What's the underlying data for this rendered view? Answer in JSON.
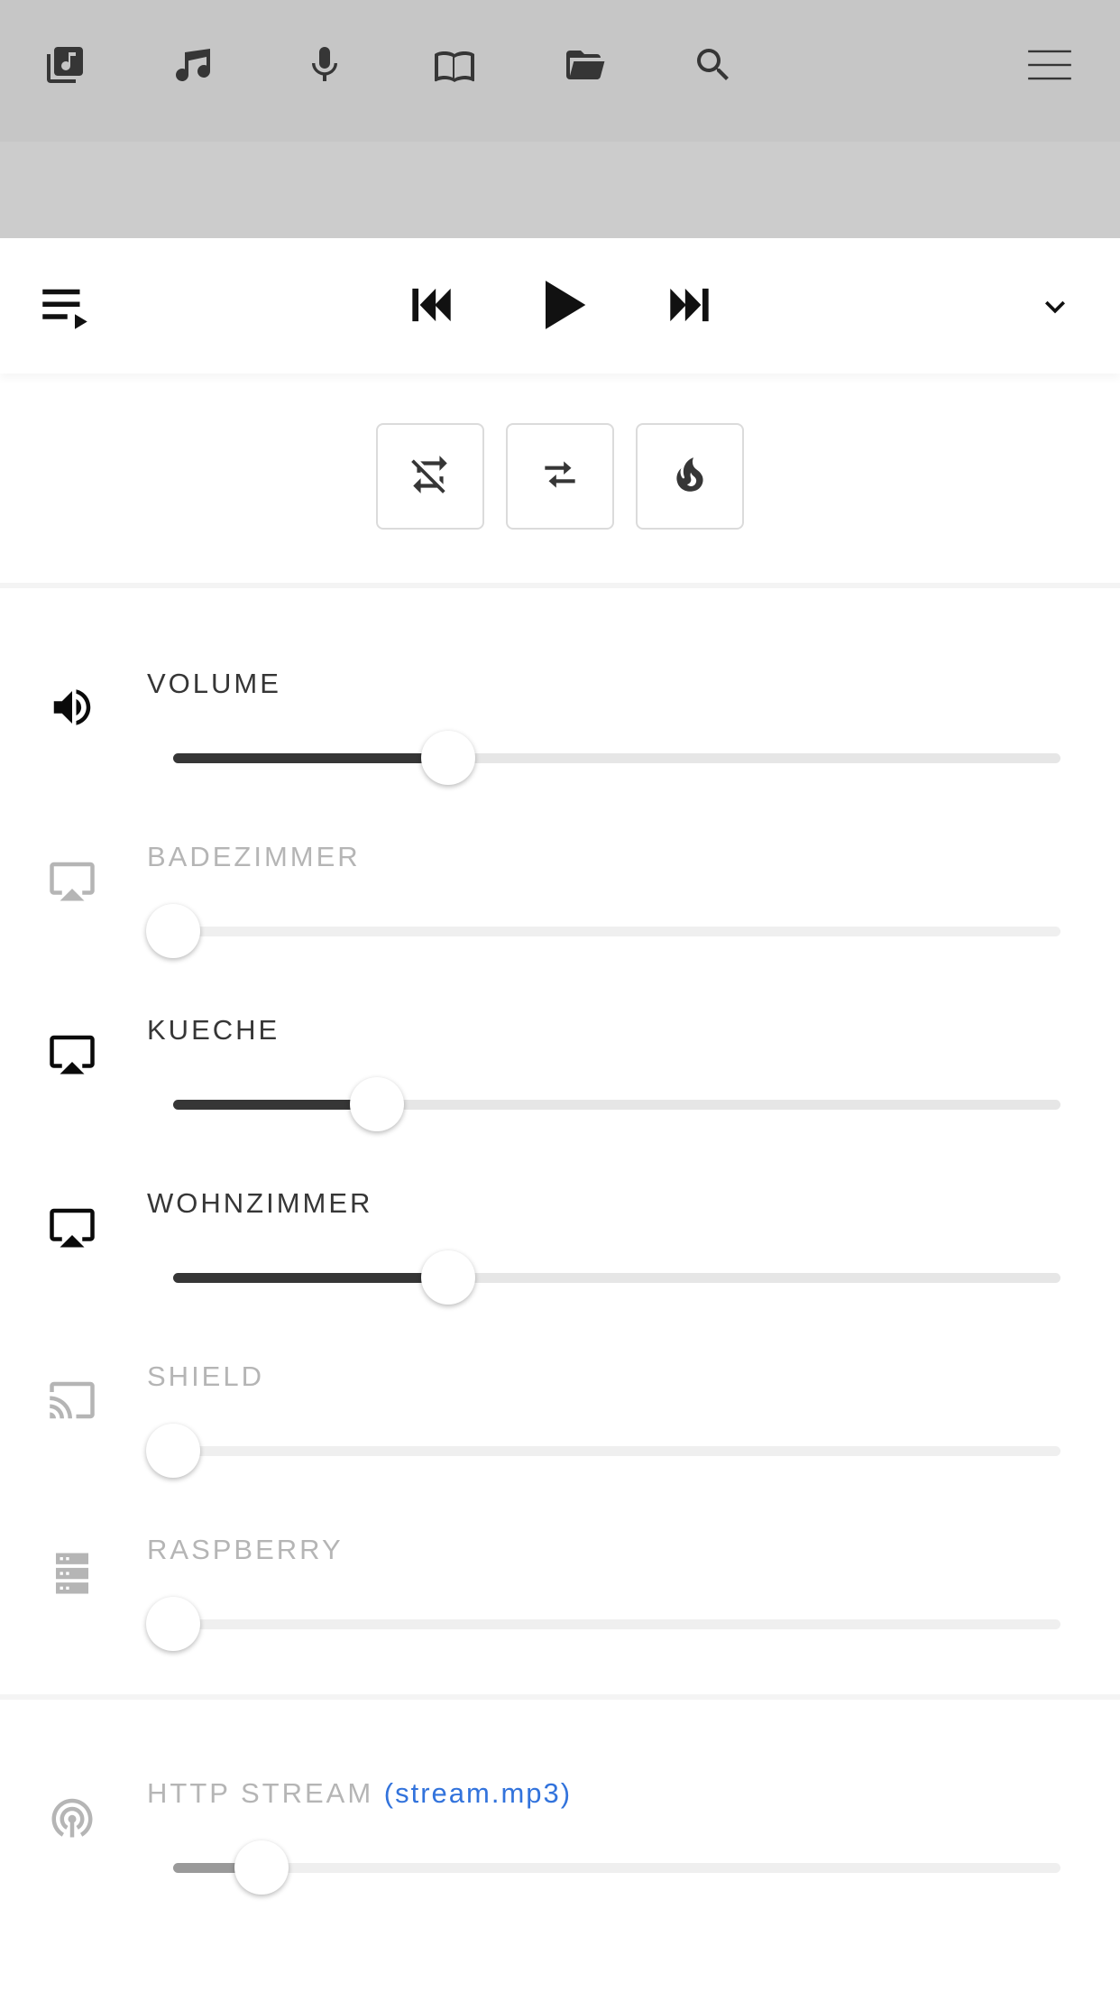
{
  "top_nav": {
    "items": [
      {
        "icon": "music-library-icon"
      },
      {
        "icon": "music-note-icon"
      },
      {
        "icon": "microphone-icon"
      },
      {
        "icon": "book-icon"
      },
      {
        "icon": "folder-open-icon"
      },
      {
        "icon": "search-icon"
      }
    ],
    "menu_icon": "hamburger-menu-icon"
  },
  "player": {
    "queue_icon": "playlist-play-icon",
    "prev_icon": "skip-previous-icon",
    "play_icon": "play-icon",
    "next_icon": "skip-next-icon",
    "collapse_icon": "chevron-down-icon"
  },
  "modes": [
    {
      "icon": "repeat-off-icon"
    },
    {
      "icon": "shuffle-off-icon"
    },
    {
      "icon": "fire-icon"
    }
  ],
  "outputs": [
    {
      "label": "VOLUME",
      "icon": "volume-high-icon",
      "level": 0.31,
      "enabled": true
    },
    {
      "label": "BADEZIMMER",
      "icon": "airplay-icon",
      "level": 0.0,
      "enabled": false
    },
    {
      "label": "KUECHE",
      "icon": "airplay-icon",
      "level": 0.23,
      "enabled": true
    },
    {
      "label": "WOHNZIMMER",
      "icon": "airplay-icon",
      "level": 0.31,
      "enabled": true
    },
    {
      "label": "SHIELD",
      "icon": "cast-icon",
      "level": 0.0,
      "enabled": false
    },
    {
      "label": "RASPBERRY",
      "icon": "server-icon",
      "level": 0.0,
      "enabled": false
    }
  ],
  "stream": {
    "label": "HTTP STREAM",
    "link_text": "(stream.mp3)",
    "icon": "access-point-icon",
    "level": 0.1,
    "enabled": false
  },
  "colors": {
    "top_nav_bg": "#c6c6c6",
    "subbar_bg": "#cccccc",
    "text_dark": "#363636",
    "text_disabled": "#b5b5b5",
    "link": "#3273dc"
  }
}
